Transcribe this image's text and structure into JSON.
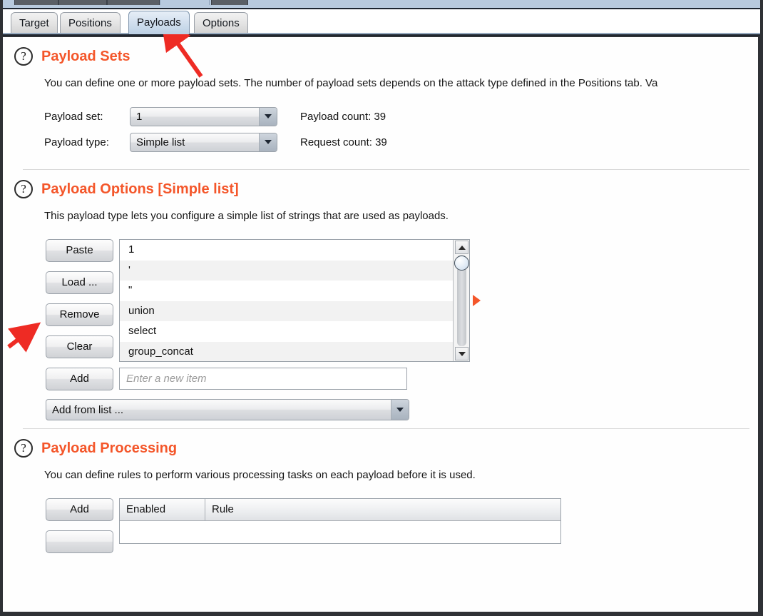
{
  "window": {
    "upper_tab_stubs": [
      "",
      "",
      "",
      "",
      ""
    ]
  },
  "tabs": [
    {
      "label": "Target",
      "selected": false
    },
    {
      "label": "Positions",
      "selected": false
    },
    {
      "label": "Payloads",
      "selected": true
    },
    {
      "label": "Options",
      "selected": false
    }
  ],
  "payload_sets": {
    "title": "Payload Sets",
    "help_icon": "question-mark-icon",
    "description": "You can define one or more payload sets. The number of payload sets depends on the attack type defined in the Positions tab. Va",
    "payload_set_label": "Payload set:",
    "payload_set_value": "1",
    "payload_type_label": "Payload type:",
    "payload_type_value": "Simple list",
    "payload_count_label": "Payload count:  39",
    "request_count_label": "Request count:  39"
  },
  "payload_options": {
    "title": "Payload Options [Simple list]",
    "help_icon": "question-mark-icon",
    "description": "This payload type lets you configure a simple list of strings that are used as payloads.",
    "buttons": {
      "paste": "Paste",
      "load": "Load ...",
      "remove": "Remove",
      "clear": "Clear",
      "add": "Add"
    },
    "list_items": [
      "1",
      "'",
      "\"",
      "union",
      "select",
      "group_concat"
    ],
    "add_item_placeholder": "Enter a new item",
    "add_from_list_value": "Add from list ..."
  },
  "payload_processing": {
    "title": "Payload Processing",
    "help_icon": "question-mark-icon",
    "description": "You can define rules to perform various processing tasks on each payload before it is used.",
    "add_button": "Add",
    "columns": {
      "enabled": "Enabled",
      "rule": "Rule"
    }
  },
  "colors": {
    "section_title": "#f4562a",
    "annotation_arrow": "#ee2b24",
    "selected_tab": "#cddcec",
    "expander": "#f4562a"
  }
}
